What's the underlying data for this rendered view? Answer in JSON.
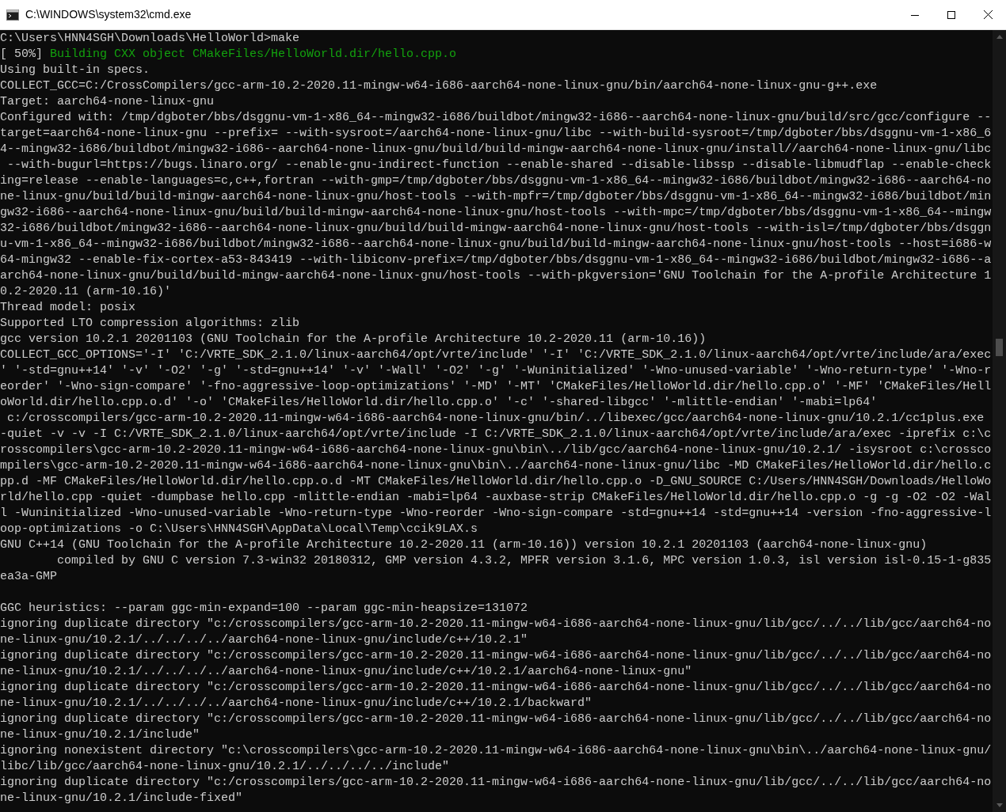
{
  "window": {
    "title": "C:\\WINDOWS\\system32\\cmd.exe"
  },
  "lines": [
    {
      "kind": "plain",
      "text": "C:\\Users\\HNN4SGH\\Downloads\\HelloWorld>make"
    },
    {
      "kind": "progress",
      "percent": "[ 50%]",
      "message": "Building CXX object CMakeFiles/HelloWorld.dir/hello.cpp.o"
    },
    {
      "kind": "plain",
      "text": "Using built-in specs."
    },
    {
      "kind": "plain",
      "text": "COLLECT_GCC=C:/CrossCompilers/gcc-arm-10.2-2020.11-mingw-w64-i686-aarch64-none-linux-gnu/bin/aarch64-none-linux-gnu-g++.exe"
    },
    {
      "kind": "plain",
      "text": "Target: aarch64-none-linux-gnu"
    },
    {
      "kind": "plain",
      "text": "Configured with: /tmp/dgboter/bbs/dsggnu-vm-1-x86_64--mingw32-i686/buildbot/mingw32-i686--aarch64-none-linux-gnu/build/src/gcc/configure --"
    },
    {
      "kind": "plain",
      "text": "target=aarch64-none-linux-gnu --prefix= --with-sysroot=/aarch64-none-linux-gnu/libc --with-build-sysroot=/tmp/dgboter/bbs/dsggnu-vm-1-x86_6"
    },
    {
      "kind": "plain",
      "text": "4--mingw32-i686/buildbot/mingw32-i686--aarch64-none-linux-gnu/build/build-mingw-aarch64-none-linux-gnu/install//aarch64-none-linux-gnu/libc"
    },
    {
      "kind": "plain",
      "text": " --with-bugurl=https://bugs.linaro.org/ --enable-gnu-indirect-function --enable-shared --disable-libssp --disable-libmudflap --enable-check"
    },
    {
      "kind": "plain",
      "text": "ing=release --enable-languages=c,c++,fortran --with-gmp=/tmp/dgboter/bbs/dsggnu-vm-1-x86_64--mingw32-i686/buildbot/mingw32-i686--aarch64-no"
    },
    {
      "kind": "plain",
      "text": "ne-linux-gnu/build/build-mingw-aarch64-none-linux-gnu/host-tools --with-mpfr=/tmp/dgboter/bbs/dsggnu-vm-1-x86_64--mingw32-i686/buildbot/min"
    },
    {
      "kind": "plain",
      "text": "gw32-i686--aarch64-none-linux-gnu/build/build-mingw-aarch64-none-linux-gnu/host-tools --with-mpc=/tmp/dgboter/bbs/dsggnu-vm-1-x86_64--mingw"
    },
    {
      "kind": "plain",
      "text": "32-i686/buildbot/mingw32-i686--aarch64-none-linux-gnu/build/build-mingw-aarch64-none-linux-gnu/host-tools --with-isl=/tmp/dgboter/bbs/dsggn"
    },
    {
      "kind": "plain",
      "text": "u-vm-1-x86_64--mingw32-i686/buildbot/mingw32-i686--aarch64-none-linux-gnu/build/build-mingw-aarch64-none-linux-gnu/host-tools --host=i686-w"
    },
    {
      "kind": "plain",
      "text": "64-mingw32 --enable-fix-cortex-a53-843419 --with-libiconv-prefix=/tmp/dgboter/bbs/dsggnu-vm-1-x86_64--mingw32-i686/buildbot/mingw32-i686--a"
    },
    {
      "kind": "plain",
      "text": "arch64-none-linux-gnu/build/build-mingw-aarch64-none-linux-gnu/host-tools --with-pkgversion='GNU Toolchain for the A-profile Architecture 1"
    },
    {
      "kind": "plain",
      "text": "0.2-2020.11 (arm-10.16)'"
    },
    {
      "kind": "plain",
      "text": "Thread model: posix"
    },
    {
      "kind": "plain",
      "text": "Supported LTO compression algorithms: zlib"
    },
    {
      "kind": "plain",
      "text": "gcc version 10.2.1 20201103 (GNU Toolchain for the A-profile Architecture 10.2-2020.11 (arm-10.16))"
    },
    {
      "kind": "plain",
      "text": "COLLECT_GCC_OPTIONS='-I' 'C:/VRTE_SDK_2.1.0/linux-aarch64/opt/vrte/include' '-I' 'C:/VRTE_SDK_2.1.0/linux-aarch64/opt/vrte/include/ara/exec"
    },
    {
      "kind": "plain",
      "text": "' '-std=gnu++14' '-v' '-O2' '-g' '-std=gnu++14' '-v' '-Wall' '-O2' '-g' '-Wuninitialized' '-Wno-unused-variable' '-Wno-return-type' '-Wno-r"
    },
    {
      "kind": "plain",
      "text": "eorder' '-Wno-sign-compare' '-fno-aggressive-loop-optimizations' '-MD' '-MT' 'CMakeFiles/HelloWorld.dir/hello.cpp.o' '-MF' 'CMakeFiles/Hell"
    },
    {
      "kind": "plain",
      "text": "oWorld.dir/hello.cpp.o.d' '-o' 'CMakeFiles/HelloWorld.dir/hello.cpp.o' '-c' '-shared-libgcc' '-mlittle-endian' '-mabi=lp64'"
    },
    {
      "kind": "plain",
      "text": " c:/crosscompilers/gcc-arm-10.2-2020.11-mingw-w64-i686-aarch64-none-linux-gnu/bin/../libexec/gcc/aarch64-none-linux-gnu/10.2.1/cc1plus.exe"
    },
    {
      "kind": "plain",
      "text": "-quiet -v -v -I C:/VRTE_SDK_2.1.0/linux-aarch64/opt/vrte/include -I C:/VRTE_SDK_2.1.0/linux-aarch64/opt/vrte/include/ara/exec -iprefix c:\\c"
    },
    {
      "kind": "plain",
      "text": "rosscompilers\\gcc-arm-10.2-2020.11-mingw-w64-i686-aarch64-none-linux-gnu\\bin\\../lib/gcc/aarch64-none-linux-gnu/10.2.1/ -isysroot c:\\crossco"
    },
    {
      "kind": "plain",
      "text": "mpilers\\gcc-arm-10.2-2020.11-mingw-w64-i686-aarch64-none-linux-gnu\\bin\\../aarch64-none-linux-gnu/libc -MD CMakeFiles/HelloWorld.dir/hello.c"
    },
    {
      "kind": "plain",
      "text": "pp.d -MF CMakeFiles/HelloWorld.dir/hello.cpp.o.d -MT CMakeFiles/HelloWorld.dir/hello.cpp.o -D_GNU_SOURCE C:/Users/HNN4SGH/Downloads/HelloWo"
    },
    {
      "kind": "plain",
      "text": "rld/hello.cpp -quiet -dumpbase hello.cpp -mlittle-endian -mabi=lp64 -auxbase-strip CMakeFiles/HelloWorld.dir/hello.cpp.o -g -g -O2 -O2 -Wal"
    },
    {
      "kind": "plain",
      "text": "l -Wuninitialized -Wno-unused-variable -Wno-return-type -Wno-reorder -Wno-sign-compare -std=gnu++14 -std=gnu++14 -version -fno-aggressive-l"
    },
    {
      "kind": "plain",
      "text": "oop-optimizations -o C:\\Users\\HNN4SGH\\AppData\\Local\\Temp\\ccik9LAX.s"
    },
    {
      "kind": "plain",
      "text": "GNU C++14 (GNU Toolchain for the A-profile Architecture 10.2-2020.11 (arm-10.16)) version 10.2.1 20201103 (aarch64-none-linux-gnu)"
    },
    {
      "kind": "plain",
      "text": "        compiled by GNU C version 7.3-win32 20180312, GMP version 4.3.2, MPFR version 3.1.6, MPC version 1.0.3, isl version isl-0.15-1-g835"
    },
    {
      "kind": "plain",
      "text": "ea3a-GMP"
    },
    {
      "kind": "blank"
    },
    {
      "kind": "plain",
      "text": "GGC heuristics: --param ggc-min-expand=100 --param ggc-min-heapsize=131072"
    },
    {
      "kind": "plain",
      "text": "ignoring duplicate directory \"c:/crosscompilers/gcc-arm-10.2-2020.11-mingw-w64-i686-aarch64-none-linux-gnu/lib/gcc/../../lib/gcc/aarch64-no"
    },
    {
      "kind": "plain",
      "text": "ne-linux-gnu/10.2.1/../../../../aarch64-none-linux-gnu/include/c++/10.2.1\""
    },
    {
      "kind": "plain",
      "text": "ignoring duplicate directory \"c:/crosscompilers/gcc-arm-10.2-2020.11-mingw-w64-i686-aarch64-none-linux-gnu/lib/gcc/../../lib/gcc/aarch64-no"
    },
    {
      "kind": "plain",
      "text": "ne-linux-gnu/10.2.1/../../../../aarch64-none-linux-gnu/include/c++/10.2.1/aarch64-none-linux-gnu\""
    },
    {
      "kind": "plain",
      "text": "ignoring duplicate directory \"c:/crosscompilers/gcc-arm-10.2-2020.11-mingw-w64-i686-aarch64-none-linux-gnu/lib/gcc/../../lib/gcc/aarch64-no"
    },
    {
      "kind": "plain",
      "text": "ne-linux-gnu/10.2.1/../../../../aarch64-none-linux-gnu/include/c++/10.2.1/backward\""
    },
    {
      "kind": "plain",
      "text": "ignoring duplicate directory \"c:/crosscompilers/gcc-arm-10.2-2020.11-mingw-w64-i686-aarch64-none-linux-gnu/lib/gcc/../../lib/gcc/aarch64-no"
    },
    {
      "kind": "plain",
      "text": "ne-linux-gnu/10.2.1/include\""
    },
    {
      "kind": "plain",
      "text": "ignoring nonexistent directory \"c:\\crosscompilers\\gcc-arm-10.2-2020.11-mingw-w64-i686-aarch64-none-linux-gnu\\bin\\../aarch64-none-linux-gnu/"
    },
    {
      "kind": "plain",
      "text": "libc/lib/gcc/aarch64-none-linux-gnu/10.2.1/../../../../include\""
    },
    {
      "kind": "plain",
      "text": "ignoring duplicate directory \"c:/crosscompilers/gcc-arm-10.2-2020.11-mingw-w64-i686-aarch64-none-linux-gnu/lib/gcc/../../lib/gcc/aarch64-no"
    },
    {
      "kind": "plain",
      "text": "ne-linux-gnu/10.2.1/include-fixed\""
    }
  ]
}
